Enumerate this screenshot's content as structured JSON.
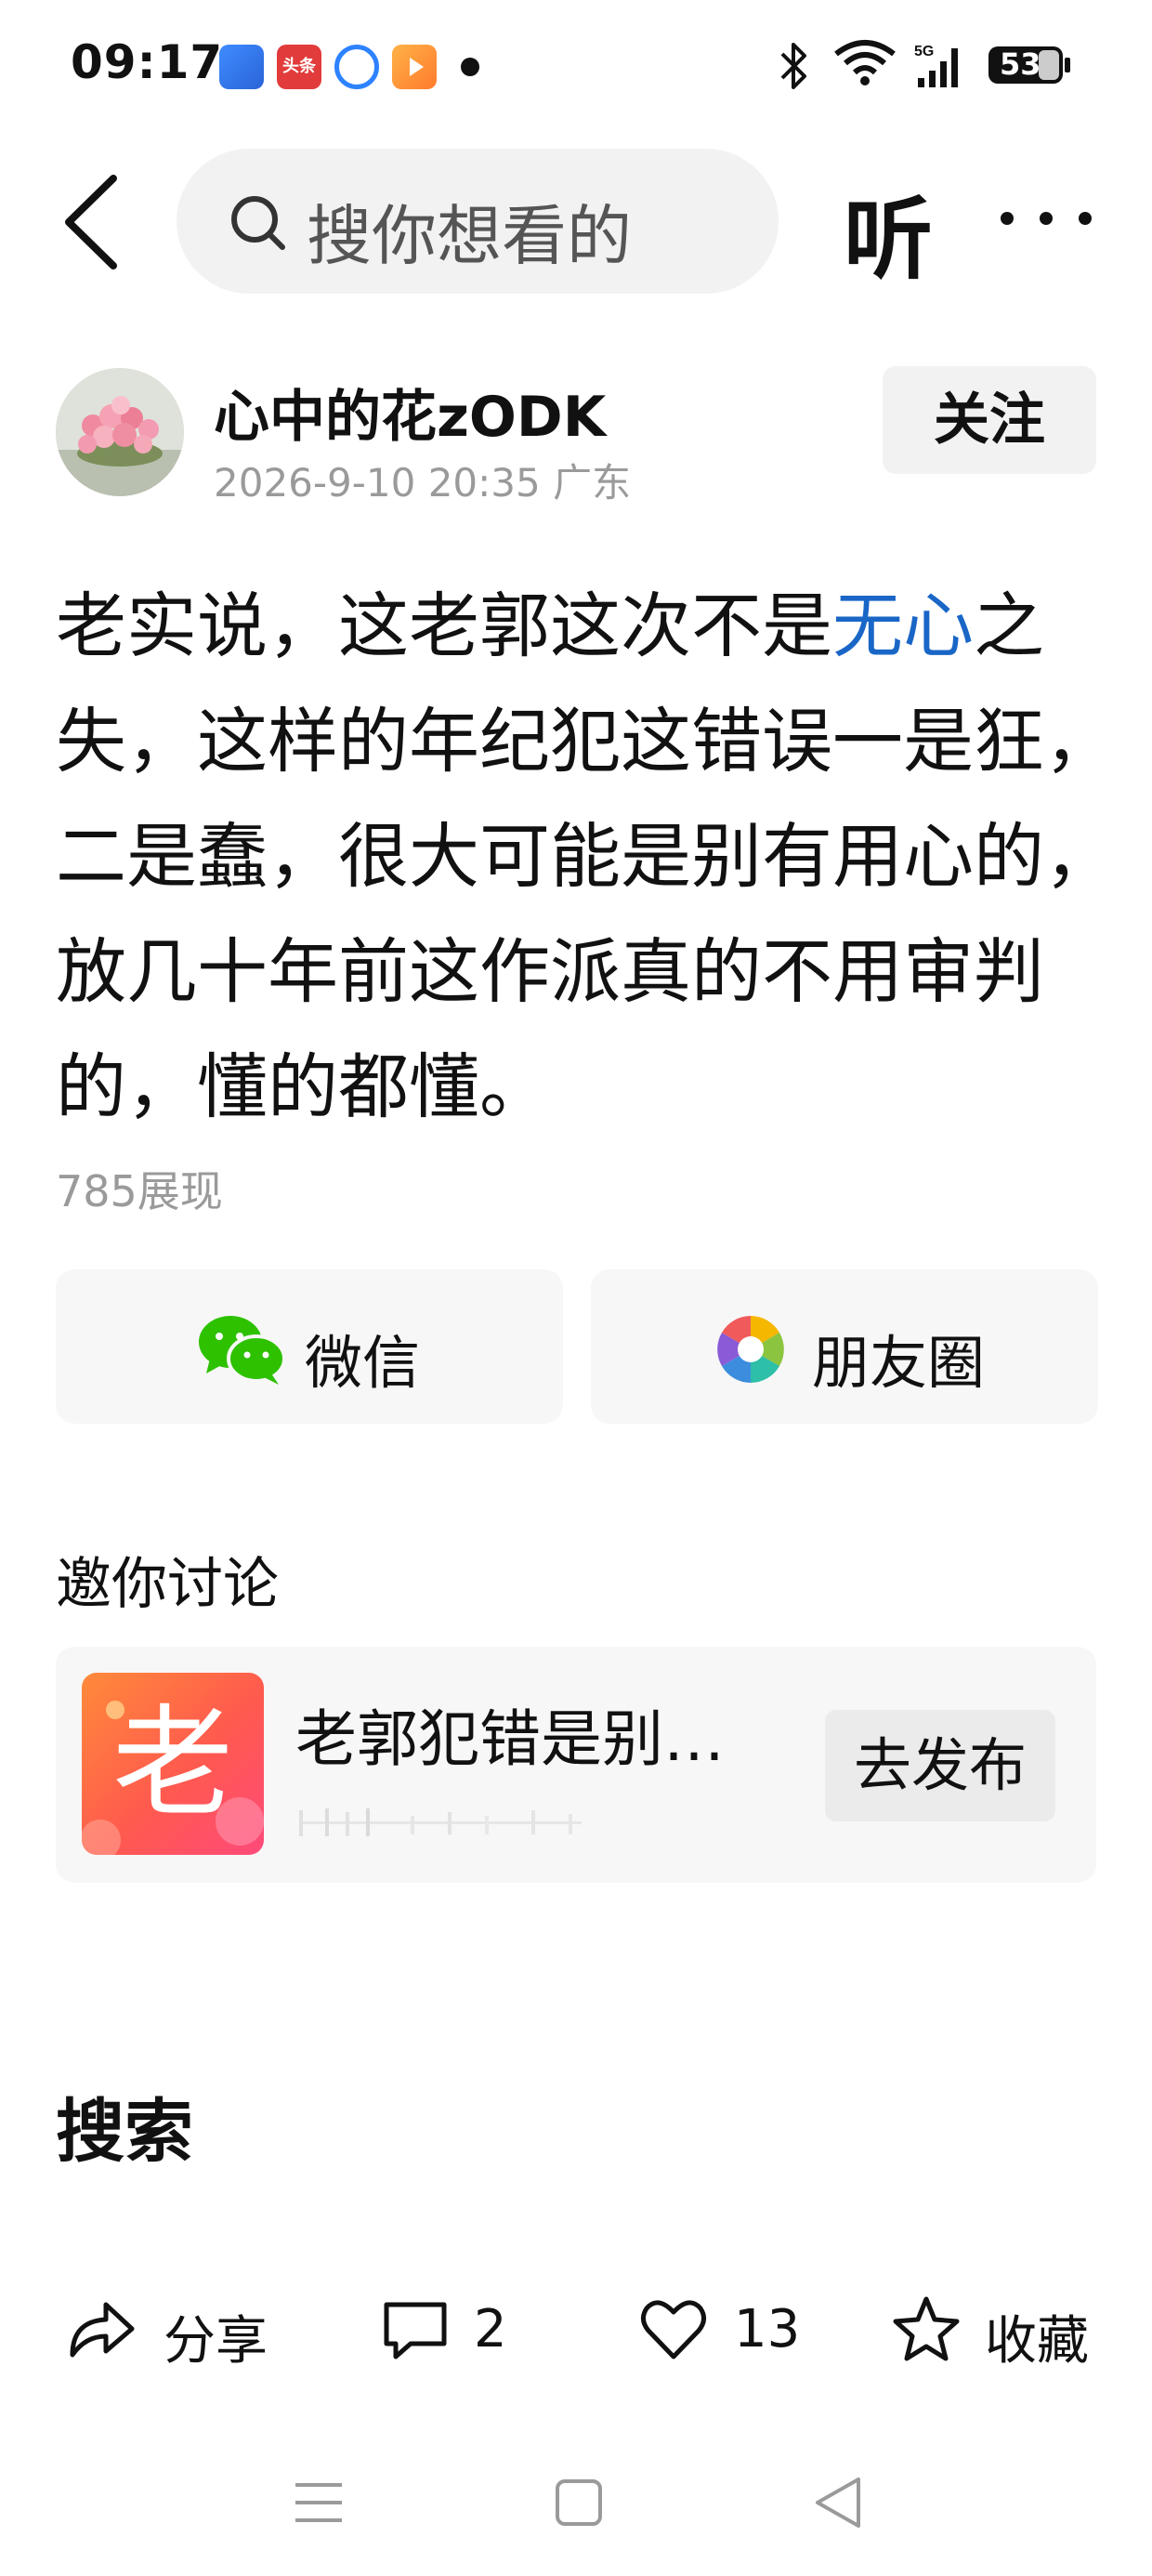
{
  "status_bar": {
    "time": "09:17",
    "notif_badge_text": "头条",
    "network": "5G",
    "battery": "53"
  },
  "nav": {
    "search_placeholder": "搜你想看的",
    "listen_label": "听"
  },
  "author": {
    "name": "心中的花zODK",
    "meta": "2026-9-10 20:35 广东",
    "follow_label": "关注"
  },
  "post": {
    "text_before": "老实说，这老郭这次不是",
    "highlight": "无心",
    "text_after": "之失，这样的年纪犯这错误一是狂，二是蠢，很大可能是别有用心的，放几十年前这作派真的不用审判的，懂的都懂。",
    "views": "785展现"
  },
  "share": {
    "wechat_label": "微信",
    "moments_label": "朋友圈"
  },
  "discuss": {
    "title": "邀你讨论",
    "thumb_char": "老",
    "topic_title": "老郭犯错是别…",
    "publish_label": "去发布"
  },
  "search_section": {
    "heading": "搜索"
  },
  "actions": {
    "share_label": "分享",
    "comment_count": "2",
    "like_count": "13",
    "favorite_label": "收藏"
  },
  "colors": {
    "highlight": "#1a66c7",
    "wechat_green": "#2dc100",
    "secondary_text": "#9a9a9a"
  }
}
